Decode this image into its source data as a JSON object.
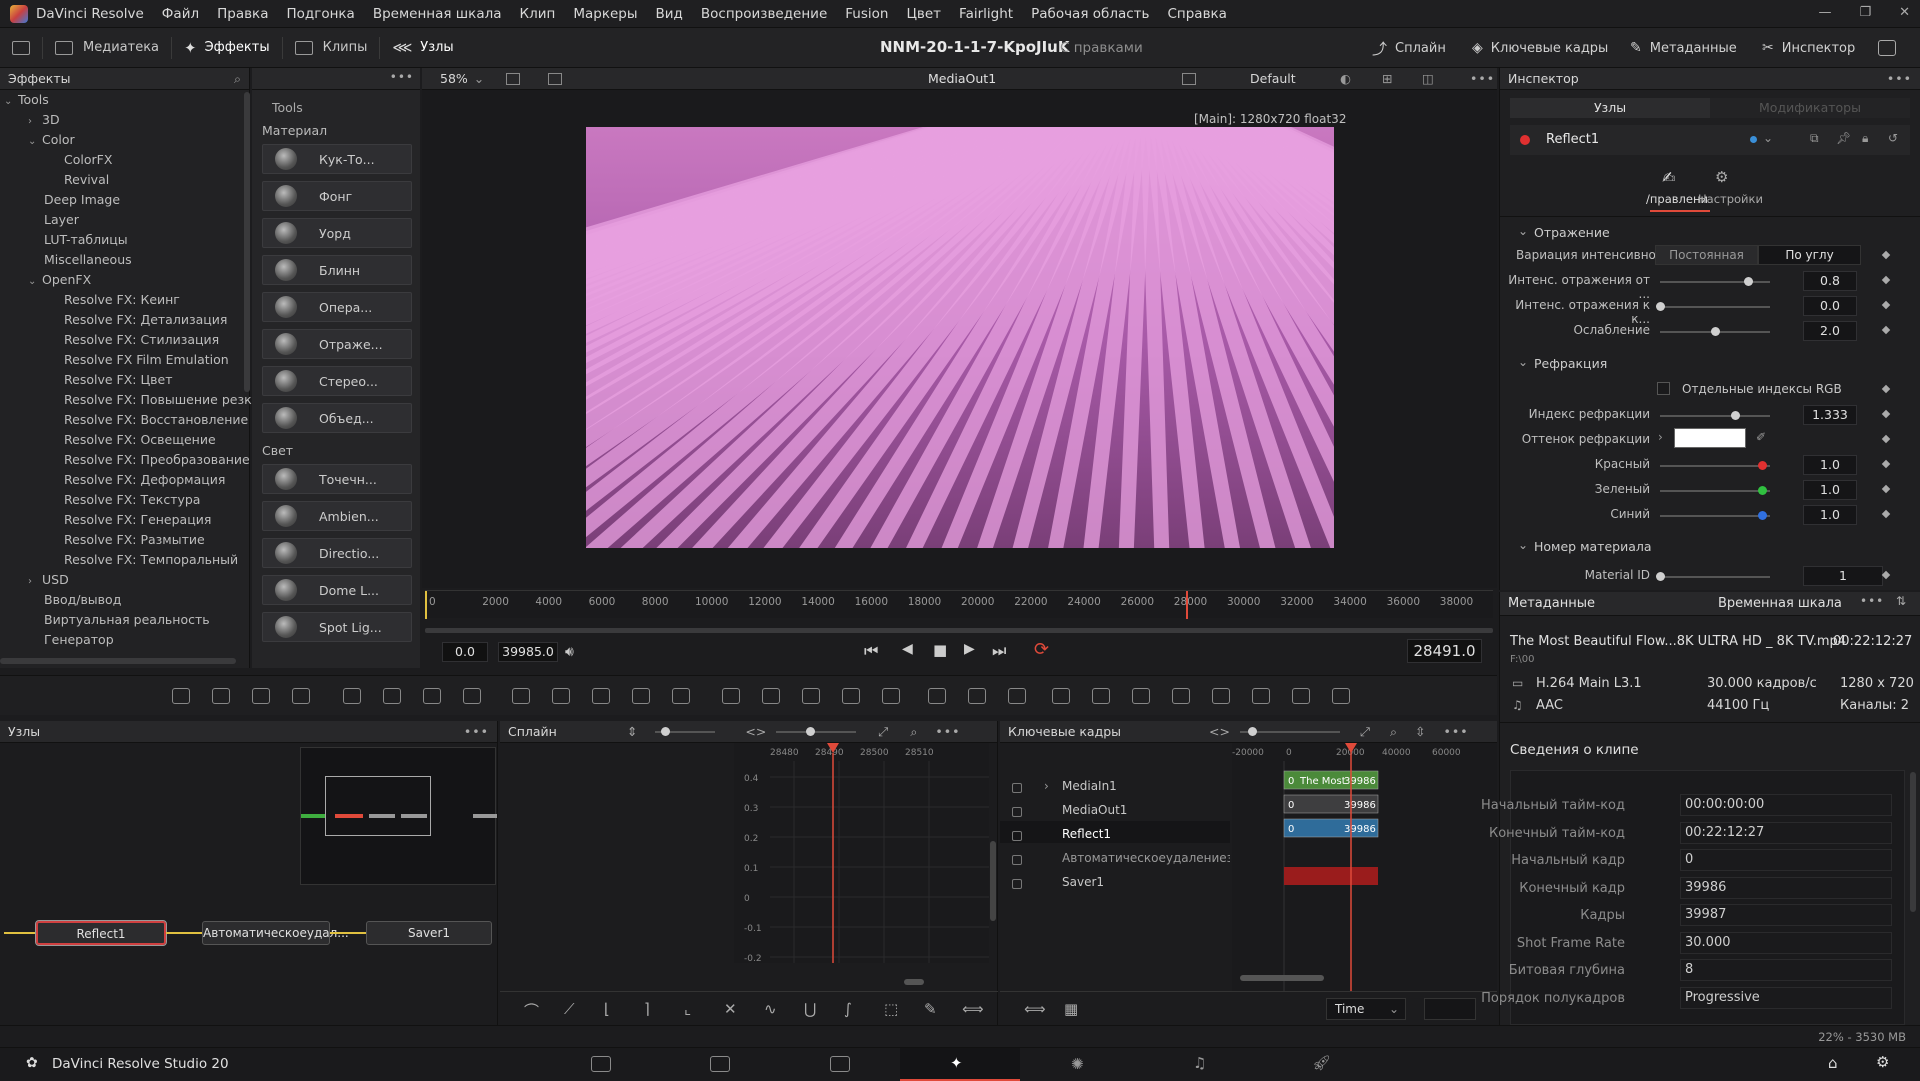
{
  "menubar": {
    "app": "DaVinci Resolve",
    "items": [
      "Файл",
      "Правка",
      "Подгонка",
      "Временная шкала",
      "Клип",
      "Маркеры",
      "Вид",
      "Воспроизведение",
      "Fusion",
      "Цвет",
      "Fairlight",
      "Рабочая область",
      "Справка"
    ]
  },
  "toolbar": {
    "media": "Медиатека",
    "effects": "Эффекты",
    "clips": "Клипы",
    "nodes": "Узлы",
    "project_title": "NNM-20-1-1-7-KpoJIuK",
    "project_status": "С правками",
    "spline": "Сплайн",
    "keyframes": "Ключевые кадры",
    "metadata": "Метаданные",
    "inspector": "Инспектор"
  },
  "effects": {
    "title": "Эффекты",
    "root": "Tools",
    "tree": [
      "3D",
      "Color",
      "ColorFX",
      "Revival",
      "Deep Image",
      "Layer",
      "LUT-таблицы",
      "Miscellaneous",
      "OpenFX",
      "Resolve FX: Кеинг",
      "Resolve FX: Детализация",
      "Resolve FX: Стилизация",
      "Resolve FX Film Emulation",
      "Resolve FX: Цвет",
      "Resolve FX: Повышение резко",
      "Resolve FX: Восстановление",
      "Resolve FX: Освещение",
      "Resolve FX: Преобразование",
      "Resolve FX: Деформация",
      "Resolve FX: Текстура",
      "Resolve FX: Генерация",
      "Resolve FX: Размытие",
      "Resolve FX: Темпоральный",
      "USD",
      "Ввод/вывод",
      "Виртуальная реальность",
      "Генератор"
    ],
    "tools_header": "Tools",
    "material_section": "Материал",
    "materials": [
      "Кук-То...",
      "Фонг",
      "Уорд",
      "Блинн",
      "Опера...",
      "Отраже...",
      "Стерео...",
      "Объед..."
    ],
    "light_section": "Свет",
    "lights": [
      "Точечн...",
      "Ambien...",
      "Directio...",
      "Dome L...",
      "Spot Lig..."
    ]
  },
  "viewer": {
    "zoom": "58%",
    "name": "MediaOut1",
    "layout": "Default",
    "frame_info": "[Main]: 1280x720 float32",
    "ruler": [
      "0",
      "2000",
      "4000",
      "6000",
      "8000",
      "10000",
      "12000",
      "14000",
      "16000",
      "18000",
      "20000",
      "22000",
      "24000",
      "26000",
      "28000",
      "30000",
      "32000",
      "34000",
      "36000",
      "38000"
    ],
    "playhead_fraction": 0.7125,
    "in_value": "0.0",
    "out_value": "39985.0",
    "current_frame": "28491.0"
  },
  "nodes_panel": {
    "title": "Узлы",
    "nodes": [
      "Reflect1",
      "Автоматическоеудал...",
      "Saver1"
    ]
  },
  "spline_panel": {
    "title": "Сплайн",
    "ruler": [
      "28480",
      "28490",
      "28500",
      "28510"
    ],
    "y_ticks": [
      "0.4",
      "0.3",
      "0.2",
      "0.1",
      "0",
      "-0.1",
      "-0.2"
    ]
  },
  "keyframes_panel": {
    "title": "Ключевые кадры",
    "ruler": [
      "-20000",
      "0",
      "20000",
      "40000",
      "60000"
    ],
    "tracks": [
      "MediaIn1",
      "MediaOut1",
      "Reflect1",
      "Автоматическоеудалениезадн",
      "Saver1"
    ],
    "bars": [
      {
        "start": "0",
        "label": "The Most",
        "end": "39986"
      },
      {
        "start": "0",
        "label": "",
        "end": "39986"
      },
      {
        "start": "0",
        "label": "",
        "end": "39986"
      }
    ],
    "time_mode": "Time"
  },
  "inspector": {
    "title": "Инспектор",
    "tab_nodes": "Узлы",
    "tab_modifiers": "Модификаторы",
    "node_name": "Reflect1",
    "subtab_controls": "/правлени",
    "subtab_settings": "Настройки",
    "sec_reflection": "Отражение",
    "var_label": "Вариация интенсивно...",
    "var_opt1": "Постоянная",
    "var_opt2": "По углу",
    "p1_label": "Интенс. отражения от ...",
    "p1_value": "0.8",
    "p1_fraction": 0.8,
    "p2_label": "Интенс. отражения к к...",
    "p2_value": "0.0",
    "p2_fraction": 0.0,
    "p3_label": "Ослабление",
    "p3_value": "2.0",
    "p3_fraction": 0.5,
    "sec_refraction": "Рефракция",
    "rgb_label": "Отдельные индексы RGB",
    "idx_label": "Индекс рефракции",
    "idx_value": "1.333",
    "idx_fraction": 0.68,
    "tint_label": "Оттенок рефракции",
    "red_label": "Красный",
    "red_value": "1.0",
    "green_label": "Зеленый",
    "green_value": "1.0",
    "blue_label": "Синий",
    "blue_value": "1.0",
    "sec_material": "Номер материала",
    "matid_label": "Material ID",
    "matid_value": "1",
    "colors": {
      "red": "#e03030",
      "green": "#30c040",
      "blue": "#3070e0",
      "accent": "#c0392b"
    }
  },
  "metadata": {
    "title": "Метаданные",
    "timeline": "Временная шкала",
    "clip_name": "The Most Beautiful Flow...8K ULTRA HD _ 8K TV.mp4",
    "duration": "00:22:12:27",
    "path": "F:\\00",
    "codec": "H.264 Main L3.1",
    "fps": "30.000 кадров/с",
    "resolution": "1280 x 720",
    "audio": "AAC",
    "audio_rate": "44100 Гц",
    "channels": "Каналы: 2",
    "clip_info_title": "Сведения о клипе",
    "rows": [
      {
        "label": "Начальный тайм-код",
        "value": "00:00:00:00"
      },
      {
        "label": "Конечный тайм-код",
        "value": "00:22:12:27"
      },
      {
        "label": "Начальный кадр",
        "value": "0"
      },
      {
        "label": "Конечный кадр",
        "value": "39986"
      },
      {
        "label": "Кадры",
        "value": "39987"
      },
      {
        "label": "Shot Frame Rate",
        "value": "30.000"
      },
      {
        "label": "Битовая глубина",
        "value": "8"
      },
      {
        "label": "Порядок полукадров",
        "value": "Progressive"
      }
    ]
  },
  "status": {
    "memory": "22% - 3530 MB",
    "app_name": "DaVinci Resolve Studio 20"
  }
}
